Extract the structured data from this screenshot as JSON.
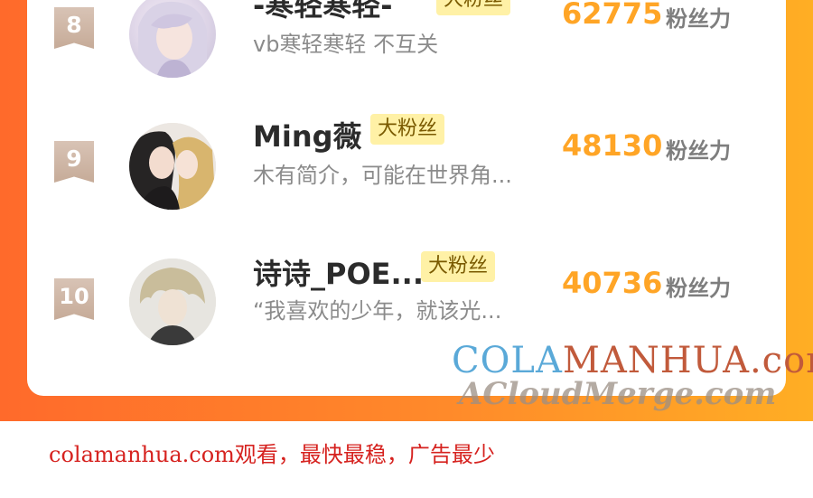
{
  "ranking": {
    "rows": [
      {
        "rank": "8",
        "name": "-寒轻寒轻-",
        "tag": "大粉丝",
        "bio": "vb寒轻寒轻 不互关",
        "score": "62775",
        "score_unit": "粉丝力"
      },
      {
        "rank": "9",
        "name": "Ming薇",
        "tag": "大粉丝",
        "bio": "木有简介，可能在世界角...",
        "score": "48130",
        "score_unit": "粉丝力"
      },
      {
        "rank": "10",
        "name": "诗诗_POE...",
        "tag": "大粉丝",
        "bio": "“我喜欢的少年，就该光...",
        "score": "40736",
        "score_unit": "粉丝力"
      }
    ]
  },
  "watermark": {
    "line1_part1": "COLA",
    "line1_part2": "MANHUA.com",
    "line2": "ACloudMerge.com"
  },
  "footer": {
    "text": "colamanhua.com观看，最快最稳，广告最少"
  },
  "colors": {
    "frame_gradient_start": "#ff6a2b",
    "frame_gradient_end": "#ffae24",
    "score": "#ffa526",
    "tag_bg": "#fff1a6",
    "footer_text": "#d6221f"
  }
}
